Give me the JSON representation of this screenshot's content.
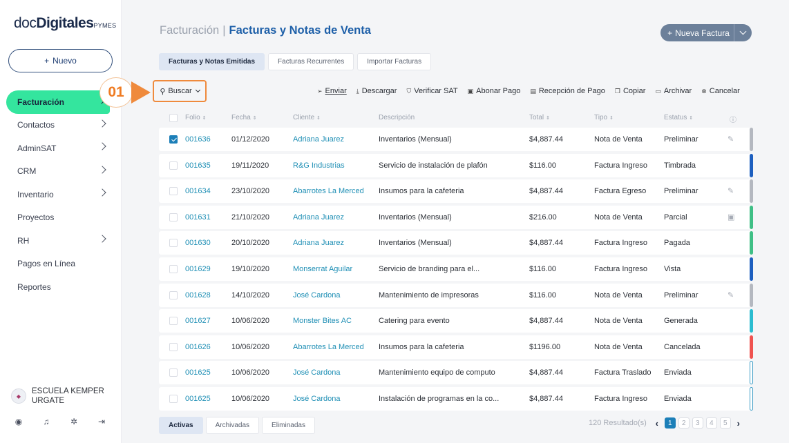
{
  "brand": {
    "doc": "doc",
    "digitales": "Digitales",
    "pymes": "PYMES"
  },
  "sidebar": {
    "new_button": "Nuevo",
    "items": [
      {
        "label": "Facturación",
        "has_children": true,
        "active": true
      },
      {
        "label": "Contactos",
        "has_children": true
      },
      {
        "label": "AdminSAT",
        "has_children": true
      },
      {
        "label": "CRM",
        "has_children": true
      },
      {
        "label": "Inventario",
        "has_children": true
      },
      {
        "label": "Proyectos",
        "has_children": false
      },
      {
        "label": "RH",
        "has_children": true
      },
      {
        "label": "Pagos en Línea",
        "has_children": false
      },
      {
        "label": "Reportes",
        "has_children": false
      }
    ],
    "school_name": "ESCUELA KEMPER URGATE",
    "bottom_icons": [
      "user-icon",
      "bell-icon",
      "gear-icon",
      "logout-icon"
    ]
  },
  "header": {
    "crumb": "Facturación",
    "separator": "|",
    "title": "Facturas y Notas de Venta",
    "new_invoice_button": "Nueva Factura"
  },
  "tabs": [
    "Facturas y Notas Emitidas",
    "Facturas Recurrentes",
    "Importar Facturas"
  ],
  "callout": "01",
  "toolbar": {
    "search": "Buscar",
    "actions": [
      {
        "label": "Enviar",
        "icon": "send-icon",
        "glyph": "➢"
      },
      {
        "label": "Descargar",
        "icon": "download-icon",
        "glyph": "⤓"
      },
      {
        "label": "Verificar SAT",
        "icon": "shield-check-icon",
        "glyph": "⛉"
      },
      {
        "label": "Abonar Pago",
        "icon": "cash-icon",
        "glyph": "▣"
      },
      {
        "label": "Recepción de Pago",
        "icon": "receipt-icon",
        "glyph": "▤"
      },
      {
        "label": "Copiar",
        "icon": "copy-icon",
        "glyph": "❐"
      },
      {
        "label": "Archivar",
        "icon": "folder-icon",
        "glyph": "▭"
      },
      {
        "label": "Cancelar",
        "icon": "cancel-icon",
        "glyph": "⊗"
      }
    ]
  },
  "table": {
    "columns": {
      "folio": "Folio",
      "fecha": "Fecha",
      "cliente": "Cliente",
      "descripcion": "Descripción",
      "total": "Total",
      "tipo": "Tipo",
      "estatus": "Estatus"
    },
    "rows": [
      {
        "checked": true,
        "folio": "001636",
        "fecha": "01/12/2020",
        "cliente": "Adriana Juarez",
        "descripcion": "Inventarios (Mensual)",
        "total": "$4,887.44",
        "tipo": "Nota de Venta",
        "estatus": "Preliminar",
        "icon": "pencil-icon",
        "color": "#b4b8c0",
        "outline": false
      },
      {
        "checked": false,
        "folio": "001635",
        "fecha": "19/11/2020",
        "cliente": "R&G Industrias",
        "descripcion": "Servicio de instalación de plafón",
        "total": "$116.00",
        "tipo": "Factura Ingreso",
        "estatus": "Timbrada",
        "icon": "",
        "color": "#1d5fbf",
        "outline": false
      },
      {
        "checked": false,
        "folio": "001634",
        "fecha": "23/10/2020",
        "cliente": "Abarrotes La Merced",
        "descripcion": "Insumos para la cafeteria",
        "total": "$4,887.44",
        "tipo": "Factura Egreso",
        "estatus": "Preliminar",
        "icon": "pencil-icon",
        "color": "#b4b8c0",
        "outline": false
      },
      {
        "checked": false,
        "folio": "001631",
        "fecha": "21/10/2020",
        "cliente": "Adriana Juarez",
        "descripcion": "Inventarios (Mensual)",
        "total": "$216.00",
        "tipo": "Nota de Venta",
        "estatus": "Parcial",
        "icon": "cash-icon",
        "color": "#3fbf86",
        "outline": false
      },
      {
        "checked": false,
        "folio": "001630",
        "fecha": "20/10/2020",
        "cliente": "Adriana Juarez",
        "descripcion": "Inventarios (Mensual)",
        "total": "$4,887.44",
        "tipo": "Factura Ingreso",
        "estatus": "Pagada",
        "icon": "",
        "color": "#3fbf86",
        "outline": false
      },
      {
        "checked": false,
        "folio": "001629",
        "fecha": "19/10/2020",
        "cliente": "Monserrat Aguilar",
        "descripcion": "Servicio de branding para el...",
        "total": "$116.00",
        "tipo": "Factura Ingreso",
        "estatus": "Vista",
        "icon": "",
        "color": "#1d5fbf",
        "outline": false
      },
      {
        "checked": false,
        "folio": "001628",
        "fecha": "14/10/2020",
        "cliente": "José Cardona",
        "descripcion": "Mantenimiento de impresoras",
        "total": "$116.00",
        "tipo": "Nota de Venta",
        "estatus": "Preliminar",
        "icon": "pencil-icon",
        "color": "#b4b8c0",
        "outline": false
      },
      {
        "checked": false,
        "folio": "001627",
        "fecha": "10/06/2020",
        "cliente": "Monster Bites AC",
        "descripcion": "Catering para evento",
        "total": "$4,887.44",
        "tipo": "Nota de Venta",
        "estatus": "Generada",
        "icon": "",
        "color": "#2bbcd0",
        "outline": false
      },
      {
        "checked": false,
        "folio": "001626",
        "fecha": "10/06/2020",
        "cliente": "Abarrotes La Merced",
        "descripcion": "Insumos para la cafeteria",
        "total": "$1196.00",
        "tipo": "Nota de Venta",
        "estatus": "Cancelada",
        "icon": "",
        "color": "#ef5350",
        "outline": false
      },
      {
        "checked": false,
        "folio": "001625",
        "fecha": "10/06/2020",
        "cliente": "José Cardona",
        "descripcion": "Mantenimiento equipo de computo",
        "total": "$4,887.44",
        "tipo": "Factura Traslado",
        "estatus": "Enviada",
        "icon": "",
        "color": "#3a9bc5",
        "outline": true
      },
      {
        "checked": false,
        "folio": "001625",
        "fecha": "10/06/2020",
        "cliente": "José Cardona",
        "descripcion": "Instalación de programas en la co...",
        "total": "$4,887.44",
        "tipo": "Factura Ingreso",
        "estatus": "Enviada",
        "icon": "",
        "color": "#3a9bc5",
        "outline": true
      }
    ]
  },
  "bottom_tabs": [
    "Activas",
    "Archivadas",
    "Eliminadas"
  ],
  "pagination": {
    "results": "120 Resultado(s)",
    "pages": [
      "1",
      "2",
      "3",
      "4",
      "5"
    ],
    "current": "1"
  }
}
